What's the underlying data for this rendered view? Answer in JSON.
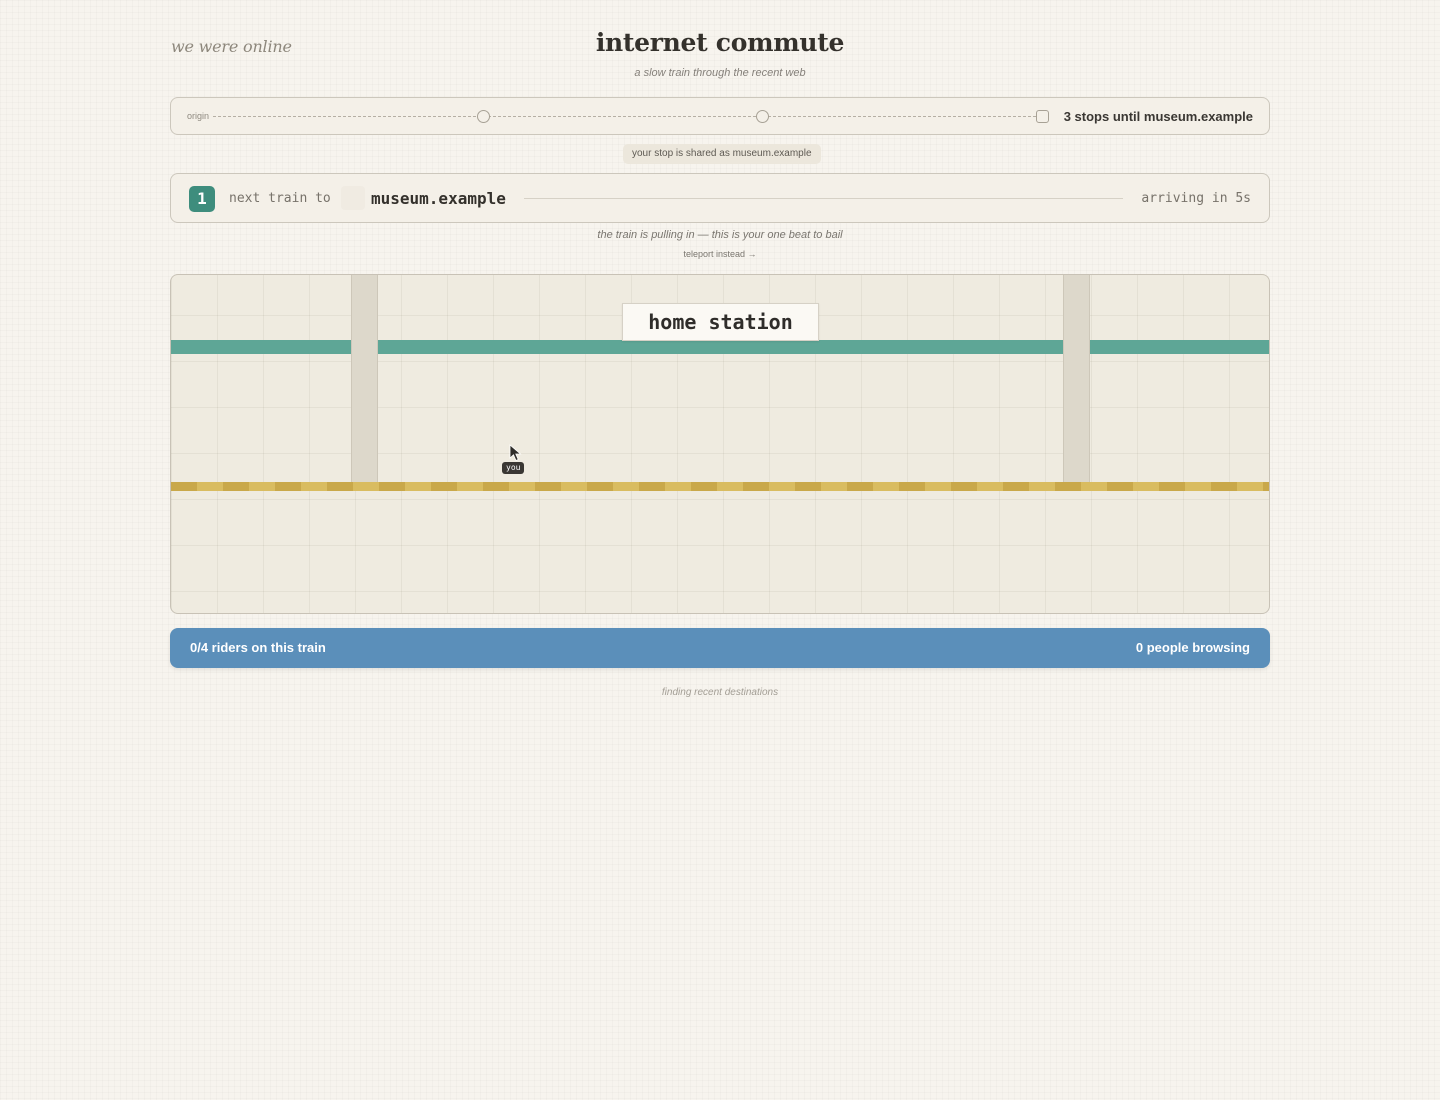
{
  "header": {
    "brand": "we were online",
    "title": "internet commute",
    "subtitle": "a slow train through the recent web"
  },
  "route": {
    "origin_label": "origin",
    "stops_text": "3 stops until museum.example",
    "stop_icons": [
      "circle-stop-icon",
      "circle-stop-icon",
      "square-destination-icon"
    ]
  },
  "share": {
    "text": "your stop is shared as museum.example"
  },
  "next_train": {
    "number": "1",
    "label": "next train to",
    "destination": "museum.example",
    "eta": "arriving in 5s"
  },
  "notice": {
    "text": "the train is pulling in — this is your one beat to bail",
    "teleport_link": "teleport instead →"
  },
  "scene": {
    "station_name": "home station",
    "cursor_icon": "pointer-cursor-icon",
    "you_label": "you"
  },
  "riders": {
    "left": "0/4 riders on this train",
    "right": "0 people browsing"
  },
  "footer": {
    "text": "finding recent destinations"
  },
  "colors": {
    "accent_green": "#3e8d7d",
    "stripe_teal": "#5ea696",
    "platform_gold": "#c9a84a",
    "riders_blue": "#5b8fba",
    "background": "#f7f4ee"
  }
}
